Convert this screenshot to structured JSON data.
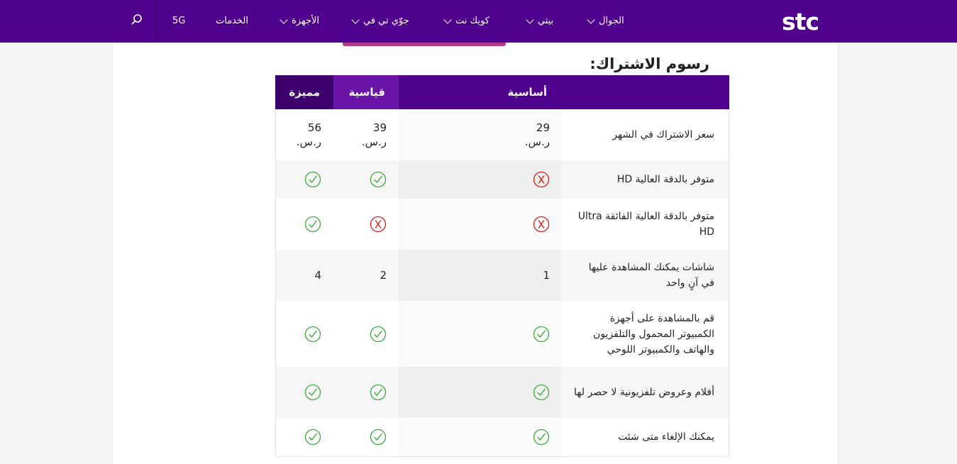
{
  "brand": {
    "logo_text": "stc"
  },
  "nav": {
    "items": [
      {
        "label": "الجوال"
      },
      {
        "label": "بيتي"
      },
      {
        "label": "كويك نت"
      },
      {
        "label": "جوّي تي في"
      },
      {
        "label": "الأجهزة"
      },
      {
        "label": "الخدمات"
      },
      {
        "label": "5G"
      }
    ]
  },
  "section": {
    "title": "رسوم الاشتراك:"
  },
  "table": {
    "headers": {
      "basic": "أساسية",
      "standard": "قياسية",
      "premium": "مميزة"
    },
    "rows": [
      {
        "label": "سعر الاشتراك في الشهر",
        "basic": "29 ر.س.",
        "standard": "39 ر.س.",
        "premium": "56 ر.س."
      },
      {
        "label": "متوفر بالدقة العالية HD",
        "basic": "cross-icon",
        "standard": "check-icon",
        "premium": "check-icon"
      },
      {
        "label": "متوفر بالدقة العالية الفائقة Ultra HD",
        "basic": "cross-icon",
        "standard": "cross-icon",
        "premium": "check-icon"
      },
      {
        "label": "شاشات يمكنك المشاهدة عليها في آنٍ واحد",
        "basic": "1",
        "standard": "2",
        "premium": "4"
      },
      {
        "label": "قم بالمشاهدة على أجهزة الكمبيوتر المحمول والتلفزيون والهاتف والكمبيوتر اللوحي",
        "basic": "check-icon",
        "standard": "check-icon",
        "premium": "check-icon"
      },
      {
        "label": "أفلام وعروض تلفزيونية لا حصر لها",
        "basic": "check-icon",
        "standard": "check-icon",
        "premium": "check-icon"
      },
      {
        "label": "يمكنك الإلغاء متى شئت",
        "basic": "check-icon",
        "standard": "check-icon",
        "premium": "check-icon"
      }
    ]
  },
  "colors": {
    "brand": "#4f008c",
    "brand_dark": "#3d006c",
    "brand_mid": "#6a14a8",
    "check": "#3aa83a",
    "cross": "#e01b1b",
    "accent": "#b03a8c"
  }
}
